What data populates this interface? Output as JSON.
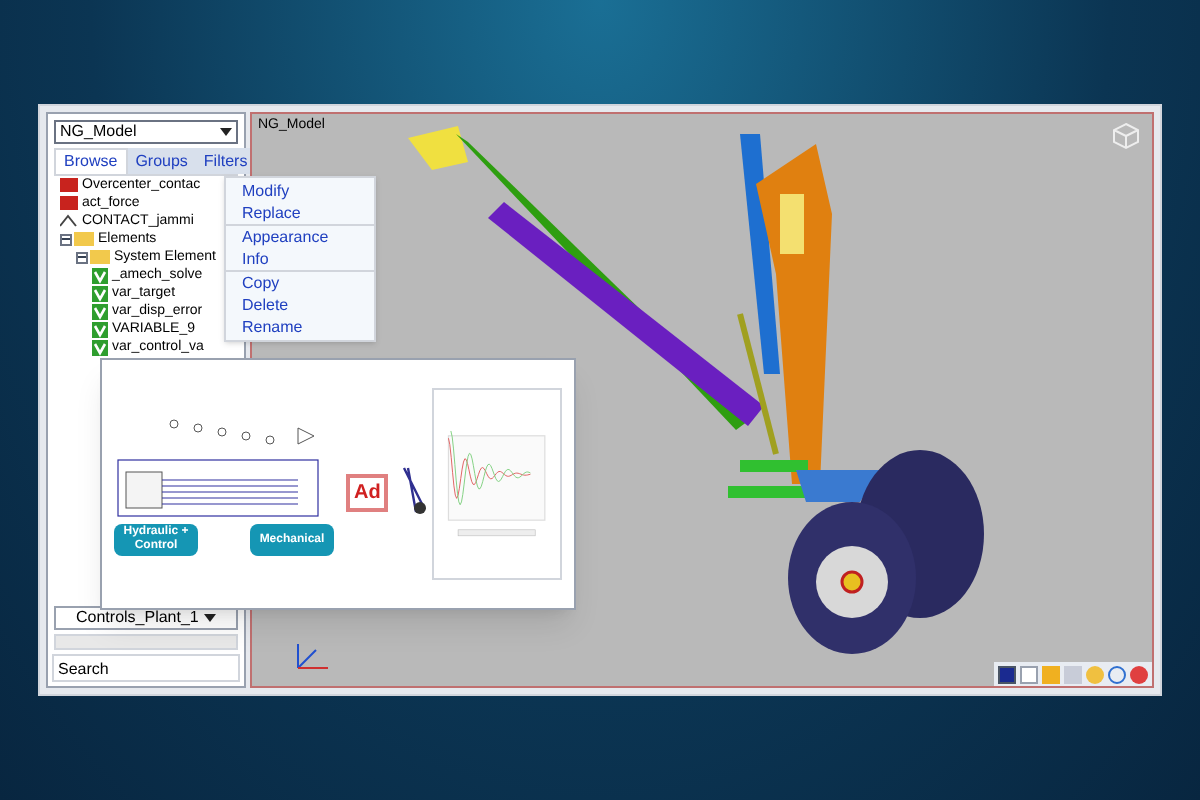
{
  "model_selector": {
    "value": "NG_Model"
  },
  "tabs": [
    {
      "label": "Browse",
      "selected": true
    },
    {
      "label": "Groups",
      "selected": false
    },
    {
      "label": "Filters",
      "selected": false
    }
  ],
  "tree": [
    {
      "label": "Overcenter_contac",
      "kind": "force"
    },
    {
      "label": "act_force",
      "kind": "force"
    },
    {
      "label": "CONTACT_jammi",
      "kind": "contact"
    },
    {
      "label": "Elements",
      "kind": "folder",
      "expanded": true,
      "children": [
        {
          "label": "System Element",
          "kind": "folder",
          "expanded": true,
          "children": [
            {
              "label": "_amech_solve",
              "kind": "variable"
            },
            {
              "label": "var_target",
              "kind": "variable"
            },
            {
              "label": "var_disp_error",
              "kind": "variable"
            },
            {
              "label": "VARIABLE_9",
              "kind": "variable"
            },
            {
              "label": "var_control_va",
              "kind": "variable"
            }
          ]
        }
      ]
    }
  ],
  "context_menu": [
    [
      {
        "label": "Modify"
      },
      {
        "label": "Replace"
      }
    ],
    [
      {
        "label": "Appearance"
      },
      {
        "label": "Info"
      }
    ],
    [
      {
        "label": "Copy"
      },
      {
        "label": "Delete"
      },
      {
        "label": "Rename"
      }
    ]
  ],
  "plant_selector": {
    "value": "Controls_Plant_1"
  },
  "search": {
    "placeholder": "Search"
  },
  "viewport": {
    "title": "NG_Model"
  },
  "inset": {
    "blocks": [
      {
        "label": "Hydraulic + Control"
      },
      {
        "label": "Mechanical"
      }
    ],
    "logo": "Ad"
  }
}
